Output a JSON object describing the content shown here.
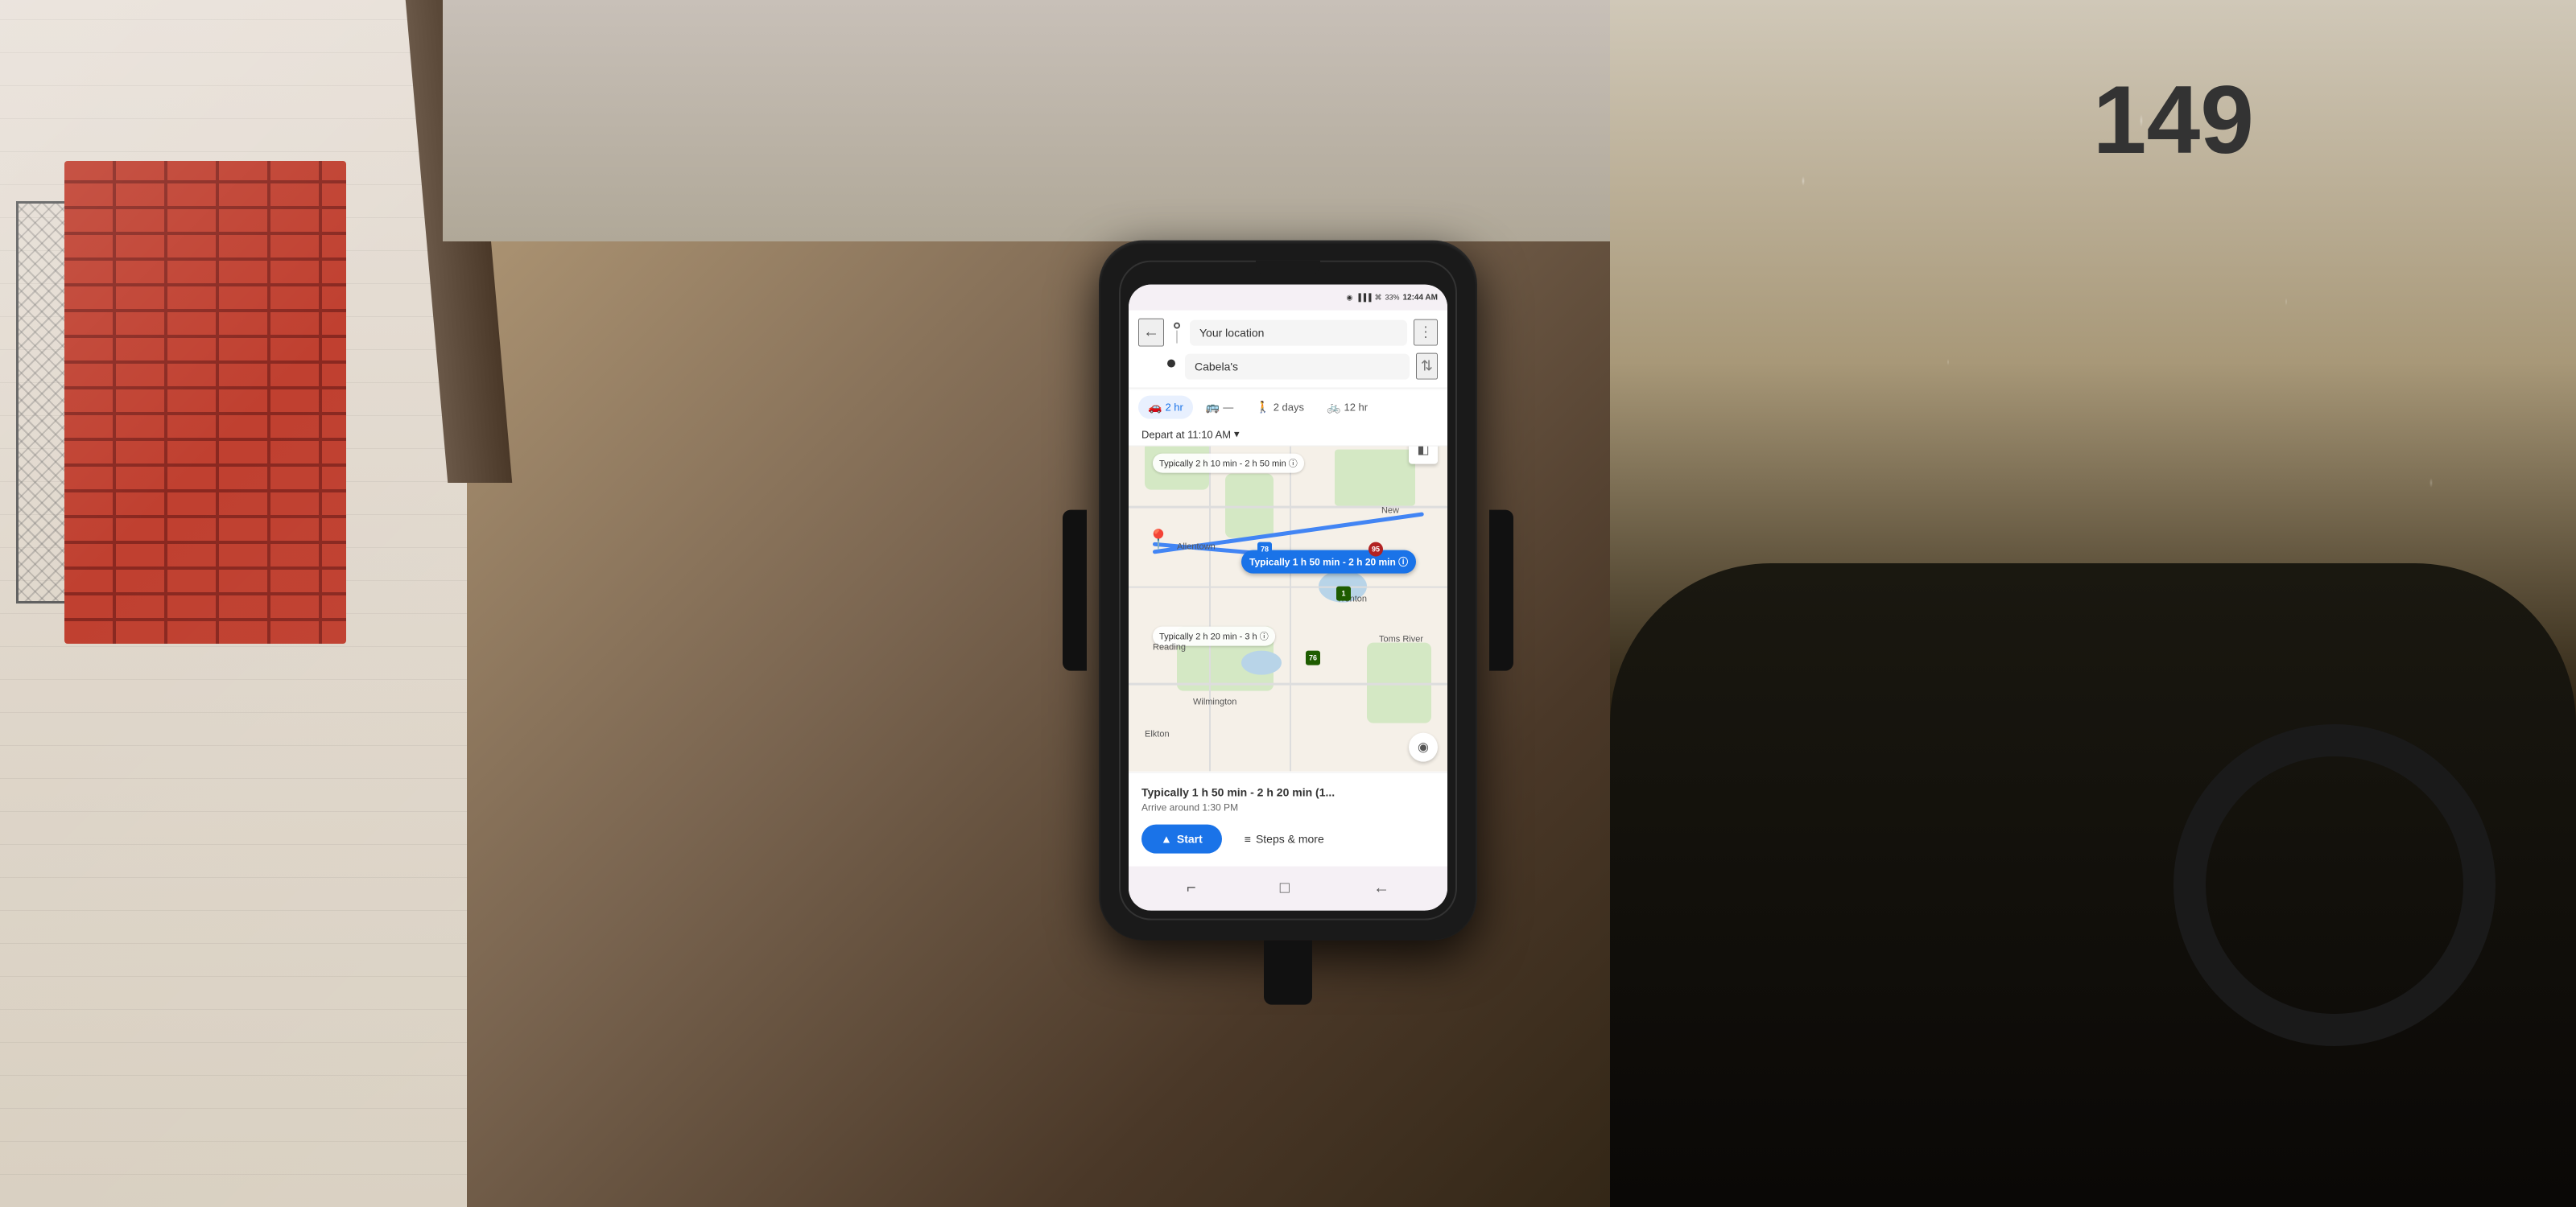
{
  "scene": {
    "building_number": "149",
    "car_background": true
  },
  "phone": {
    "status_bar": {
      "time": "12:44 AM",
      "battery": "33%",
      "signal_icon": "▐▐▐",
      "wifi_icon": "wifi",
      "location_icon": "◉"
    },
    "nav_header": {
      "back_button_label": "←",
      "more_button_label": "⋮",
      "origin": {
        "placeholder": "Your location",
        "value": "Your location",
        "icon": "⊙"
      },
      "destination": {
        "placeholder": "Cabela's",
        "value": "Cabela's",
        "icon": "●"
      },
      "swap_button_label": "⇅"
    },
    "transport_tabs": [
      {
        "id": "car",
        "label": "2 hr",
        "icon": "🚗",
        "active": true
      },
      {
        "id": "transit",
        "label": "—",
        "icon": "🚌",
        "active": false
      },
      {
        "id": "walk",
        "label": "2 days",
        "icon": "🚶",
        "active": false
      },
      {
        "id": "bike",
        "label": "12 hr",
        "icon": "🚲",
        "active": false
      }
    ],
    "depart_row": {
      "label": "Depart at 11:10 AM",
      "chevron": "▾"
    },
    "map": {
      "route_tooltip_main": "Typically 1 h 50 min - 2 h 20 min ⓘ",
      "route_label_top": "Typically 2 h 10 min - 2 h 50 min ⓘ",
      "route_label_bottom": "Typically 2 h 20 min - 3 h ⓘ",
      "layer_btn": "◧",
      "location_btn": "◉",
      "city_labels": [
        "Allentown",
        "Reading",
        "Trenton",
        "Toms River",
        "Wilmington",
        "Elkton"
      ],
      "highway_shields": [
        "78",
        "76",
        "1",
        "76"
      ]
    },
    "bottom_panel": {
      "route_summary": "Typically 1 h 50 min - 2 h 20 min (1...",
      "arrive_text": "Arrive around 1:30 PM",
      "start_button": "Start",
      "start_icon": "▲",
      "steps_button": "Steps & more",
      "steps_icon": "≡"
    },
    "android_navbar": {
      "recent_icon": "⌐",
      "home_icon": "□",
      "back_icon": "←"
    }
  }
}
